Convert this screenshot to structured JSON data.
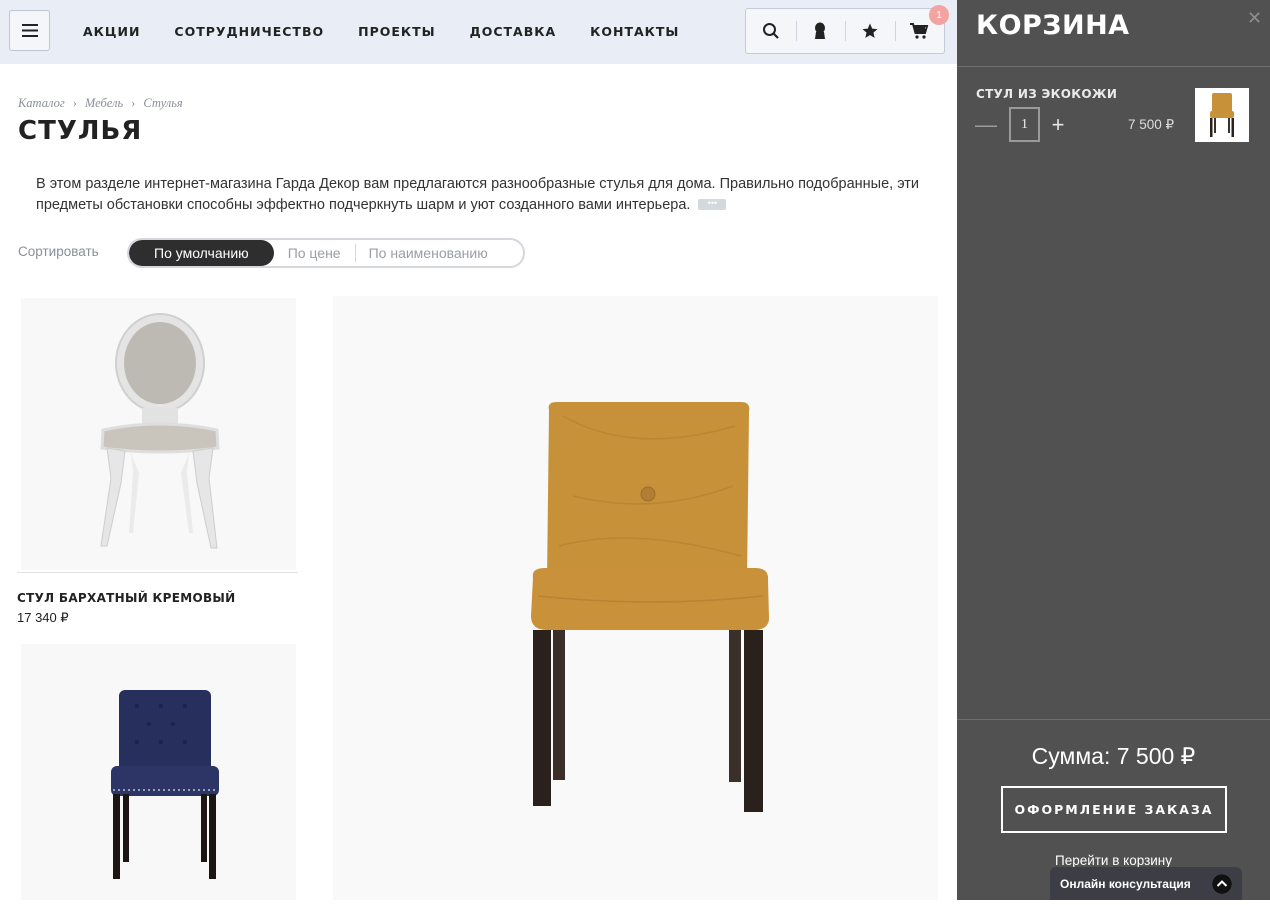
{
  "header": {
    "nav": [
      "АКЦИИ",
      "СОТРУДНИЧЕСТВО",
      "ПРОЕКТЫ",
      "ДОСТАВКА",
      "КОНТАКТЫ"
    ],
    "cart_count": "1",
    "icons": [
      "menu-icon",
      "search-icon",
      "user-icon",
      "star-icon",
      "cart-icon"
    ]
  },
  "breadcrumb": [
    "Каталог",
    "Мебель",
    "Стулья"
  ],
  "page": {
    "title": "СТУЛЬЯ",
    "description": "В этом разделе интернет-магазина Гарда Декор вам предлагаются разнообразные стулья для дома. Правильно подобранные, эти предметы обстановки способны эффектно подчеркнуть шарм и уют созданного вами интерьера.",
    "more": "•••"
  },
  "sort": {
    "label": "Сортировать",
    "options": [
      "По умолчанию",
      "По цене",
      "По наименованию"
    ],
    "active": "По умолчанию"
  },
  "products": [
    {
      "name": "СТУЛ БАРХАТНЫЙ КРЕМОВЫЙ",
      "price": "17 340 ₽"
    }
  ],
  "cart": {
    "title": "КОРЗИНА",
    "close": "✕",
    "item": {
      "name": "СТУЛ ИЗ ЭКОКОЖИ",
      "qty": "1",
      "price": "7 500 ₽"
    },
    "minus": "—",
    "plus": "+",
    "sum": "Сумма: 7 500 ₽",
    "checkout": "ОФОРМЛЕНИЕ ЗАКАЗА",
    "go_to_cart": "Перейти в корзину"
  },
  "consult": {
    "label": "Онлайн консультация"
  },
  "colors": {
    "cart_bg": "#515151",
    "header_bg": "#e9edf5",
    "badge": "#f4a3a3"
  }
}
